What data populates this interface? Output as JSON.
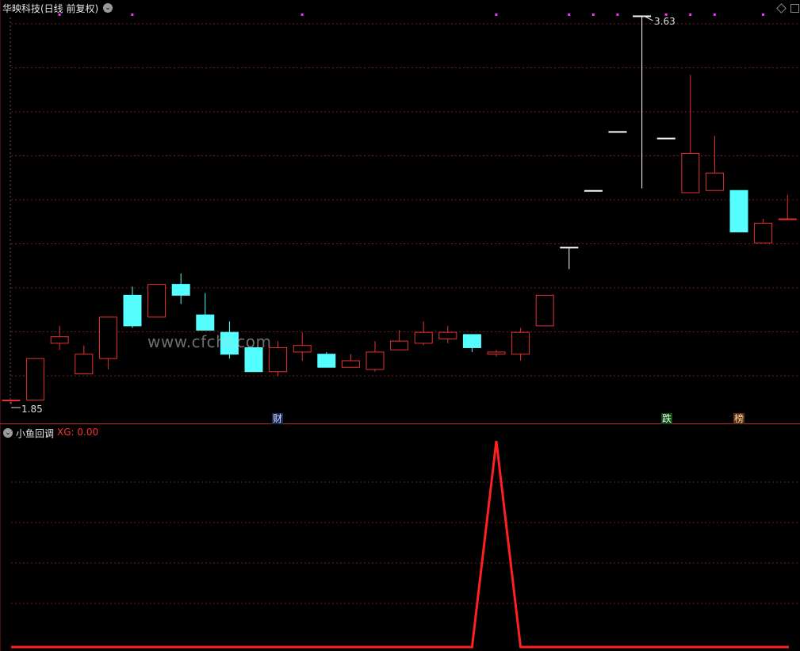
{
  "main_panel": {
    "title": "华映科技(日线 前复权)",
    "price_high_label": "3.63",
    "price_low_label": "1.85",
    "markers": [
      "财",
      "跌",
      "榜"
    ],
    "watermark": "www.cfchi.com"
  },
  "indicator_panel": {
    "title": "小鱼回调",
    "value_label": "XG: 0.00"
  },
  "colors": {
    "background": "#000000",
    "up_candle": "#e83030",
    "down_candle": "#55ffff",
    "doji": "#ffffff",
    "gridline": "#7a1a1a",
    "indicator_line": "#ff2020",
    "signal_dot": "#ff30ff",
    "tag_cai": "#60a0ff",
    "tag_die": "#40e040",
    "tag_bang": "#ffb060"
  },
  "chart_data": [
    {
      "type": "candlestick",
      "title": "华映科技(日线 前复权)",
      "ylim": [
        1.85,
        3.63
      ],
      "candles": [
        {
          "o": 1.87,
          "c": 1.87,
          "h": 1.87,
          "l": 1.85
        },
        {
          "o": 1.87,
          "c": 2.06,
          "h": 2.06,
          "l": 1.87
        },
        {
          "o": 2.13,
          "c": 2.16,
          "h": 2.21,
          "l": 2.1
        },
        {
          "o": 1.99,
          "c": 2.08,
          "h": 2.12,
          "l": 1.99
        },
        {
          "o": 2.06,
          "c": 2.25,
          "h": 2.25,
          "l": 2.01
        },
        {
          "o": 2.35,
          "c": 2.21,
          "h": 2.39,
          "l": 2.2
        },
        {
          "o": 2.25,
          "c": 2.4,
          "h": 2.4,
          "l": 2.25
        },
        {
          "o": 2.4,
          "c": 2.35,
          "h": 2.45,
          "l": 2.31
        },
        {
          "o": 2.26,
          "c": 2.19,
          "h": 2.36,
          "l": 2.19
        },
        {
          "o": 2.18,
          "c": 2.08,
          "h": 2.23,
          "l": 2.06
        },
        {
          "o": 2.11,
          "c": 2.0,
          "h": 2.11,
          "l": 2.0
        },
        {
          "o": 2.0,
          "c": 2.11,
          "h": 2.14,
          "l": 1.98
        },
        {
          "o": 2.09,
          "c": 2.12,
          "h": 2.18,
          "l": 2.05
        },
        {
          "o": 2.08,
          "c": 2.02,
          "h": 2.09,
          "l": 2.02
        },
        {
          "o": 2.02,
          "c": 2.05,
          "h": 2.08,
          "l": 2.02
        },
        {
          "o": 2.01,
          "c": 2.09,
          "h": 2.14,
          "l": 2.0
        },
        {
          "o": 2.1,
          "c": 2.14,
          "h": 2.19,
          "l": 2.1
        },
        {
          "o": 2.13,
          "c": 2.18,
          "h": 2.23,
          "l": 2.12
        },
        {
          "o": 2.15,
          "c": 2.18,
          "h": 2.21,
          "l": 2.13
        },
        {
          "o": 2.17,
          "c": 2.11,
          "h": 2.17,
          "l": 2.09
        },
        {
          "o": 2.08,
          "c": 2.09,
          "h": 2.1,
          "l": 2.07
        },
        {
          "o": 2.08,
          "c": 2.18,
          "h": 2.2,
          "l": 2.05
        },
        {
          "o": 2.21,
          "c": 2.35,
          "h": 2.35,
          "l": 2.21
        },
        {
          "o": 2.57,
          "c": 2.57,
          "h": 2.57,
          "l": 2.47
        },
        {
          "o": 2.83,
          "c": 2.83,
          "h": 2.83,
          "l": 2.83
        },
        {
          "o": 3.1,
          "c": 3.1,
          "h": 3.1,
          "l": 3.1
        },
        {
          "o": 3.63,
          "c": 3.63,
          "h": 3.63,
          "l": 2.84
        },
        {
          "o": 3.07,
          "c": 3.07,
          "h": 3.07,
          "l": 3.07
        },
        {
          "o": 2.82,
          "c": 3.0,
          "h": 3.36,
          "l": 2.82
        },
        {
          "o": 2.83,
          "c": 2.91,
          "h": 3.08,
          "l": 2.83
        },
        {
          "o": 2.83,
          "c": 2.64,
          "h": 2.83,
          "l": 2.64
        },
        {
          "o": 2.59,
          "c": 2.68,
          "h": 2.7,
          "l": 2.59
        },
        {
          "o": 2.7,
          "c": 2.7,
          "h": 2.81,
          "l": 2.7
        }
      ],
      "signal_dots": [
        1,
        4,
        11,
        19,
        22,
        23,
        24,
        26,
        27,
        28,
        30
      ]
    },
    {
      "type": "line",
      "title": "小鱼回调",
      "series": [
        {
          "name": "XG",
          "values": [
            0,
            0,
            0,
            0,
            0,
            0,
            0,
            0,
            0,
            0,
            0,
            0,
            0,
            0,
            0,
            0,
            0,
            0,
            0,
            0,
            1,
            0,
            0,
            0,
            0,
            0,
            0,
            0,
            0,
            0,
            0,
            0,
            0
          ]
        }
      ],
      "ylim": [
        0,
        1
      ]
    }
  ]
}
